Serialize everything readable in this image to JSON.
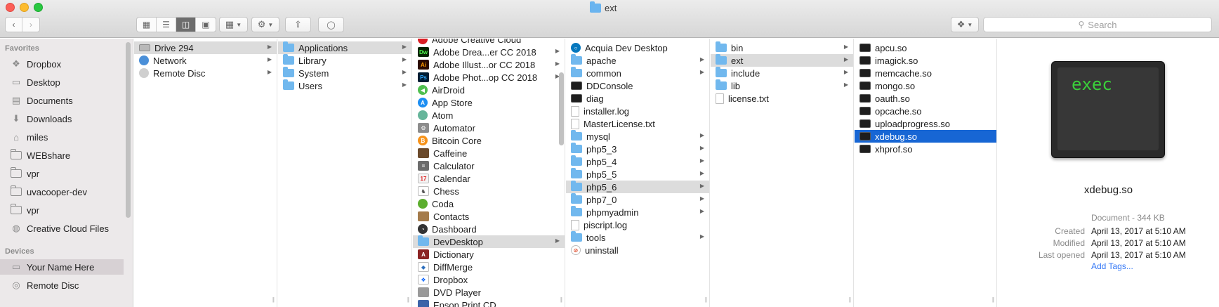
{
  "window": {
    "title": "ext",
    "search_placeholder": "Search"
  },
  "sidebar": {
    "favorites_label": "Favorites",
    "devices_label": "Devices",
    "favorites": [
      {
        "label": "Dropbox",
        "icon": "dropbox-icon"
      },
      {
        "label": "Desktop",
        "icon": "desktop-icon"
      },
      {
        "label": "Documents",
        "icon": "documents-icon"
      },
      {
        "label": "Downloads",
        "icon": "downloads-icon"
      },
      {
        "label": "miles",
        "icon": "home-icon"
      },
      {
        "label": "WEBshare",
        "icon": "folder-icon"
      },
      {
        "label": "vpr",
        "icon": "folder-icon"
      },
      {
        "label": "uvacooper-dev",
        "icon": "folder-icon"
      },
      {
        "label": "vpr",
        "icon": "folder-icon"
      },
      {
        "label": "Creative Cloud Files",
        "icon": "creative-cloud-icon"
      }
    ],
    "devices": [
      {
        "label": "Your Name Here",
        "icon": "computer-icon"
      },
      {
        "label": "Remote Disc",
        "icon": "disc-icon"
      }
    ]
  },
  "columns": {
    "col1": [
      {
        "label": "Drive 294",
        "icon": "drive-icon",
        "chevron": true,
        "selected": "grey"
      },
      {
        "label": "Network",
        "icon": "globe-icon",
        "chevron": true
      },
      {
        "label": "Remote Disc",
        "icon": "disc-icon",
        "chevron": true
      }
    ],
    "col2": [
      {
        "label": "Applications",
        "icon": "folder-icon",
        "chevron": true,
        "selected": "grey"
      },
      {
        "label": "Library",
        "icon": "folder-icon",
        "chevron": true
      },
      {
        "label": "System",
        "icon": "folder-icon",
        "chevron": true
      },
      {
        "label": "Users",
        "icon": "folder-icon",
        "chevron": true
      }
    ],
    "col3": [
      {
        "label": "Adobe Creative Cloud",
        "icon": "creative-cloud-icon"
      },
      {
        "label": "Adobe Drea...er CC 2018",
        "icon": "dreamweaver-icon",
        "chevron": true
      },
      {
        "label": "Adobe Illust...or CC 2018",
        "icon": "illustrator-icon",
        "chevron": true
      },
      {
        "label": "Adobe Phot...op CC 2018",
        "icon": "photoshop-icon",
        "chevron": true
      },
      {
        "label": "AirDroid",
        "icon": "airdroid-icon"
      },
      {
        "label": "App Store",
        "icon": "app-store-icon"
      },
      {
        "label": "Atom",
        "icon": "atom-icon"
      },
      {
        "label": "Automator",
        "icon": "automator-icon"
      },
      {
        "label": "Bitcoin Core",
        "icon": "bitcoin-icon"
      },
      {
        "label": "Caffeine",
        "icon": "caffeine-icon"
      },
      {
        "label": "Calculator",
        "icon": "calculator-icon"
      },
      {
        "label": "Calendar",
        "icon": "calendar-icon"
      },
      {
        "label": "Chess",
        "icon": "chess-icon"
      },
      {
        "label": "Coda",
        "icon": "coda-icon"
      },
      {
        "label": "Contacts",
        "icon": "contacts-icon"
      },
      {
        "label": "Dashboard",
        "icon": "dashboard-icon"
      },
      {
        "label": "DevDesktop",
        "icon": "folder-icon",
        "chevron": true,
        "selected": "grey"
      },
      {
        "label": "Dictionary",
        "icon": "dictionary-icon"
      },
      {
        "label": "DiffMerge",
        "icon": "diffmerge-icon"
      },
      {
        "label": "Dropbox",
        "icon": "dropbox-icon"
      },
      {
        "label": "DVD Player",
        "icon": "dvd-player-icon"
      },
      {
        "label": "Epson Print CD",
        "icon": "epson-icon"
      }
    ],
    "col4": [
      {
        "label": "Acquia Dev Desktop",
        "icon": "acquia-icon"
      },
      {
        "label": "apache",
        "icon": "folder-icon",
        "chevron": true
      },
      {
        "label": "common",
        "icon": "folder-icon",
        "chevron": true
      },
      {
        "label": "DDConsole",
        "icon": "terminal-icon"
      },
      {
        "label": "diag",
        "icon": "terminal-icon"
      },
      {
        "label": "installer.log",
        "icon": "document-icon"
      },
      {
        "label": "MasterLicense.txt",
        "icon": "document-icon"
      },
      {
        "label": "mysql",
        "icon": "folder-icon",
        "chevron": true
      },
      {
        "label": "php5_3",
        "icon": "folder-icon",
        "chevron": true
      },
      {
        "label": "php5_4",
        "icon": "folder-icon",
        "chevron": true
      },
      {
        "label": "php5_5",
        "icon": "folder-icon",
        "chevron": true
      },
      {
        "label": "php5_6",
        "icon": "folder-icon",
        "chevron": true,
        "selected": "grey"
      },
      {
        "label": "php7_0",
        "icon": "folder-icon",
        "chevron": true
      },
      {
        "label": "phpmyadmin",
        "icon": "folder-icon",
        "chevron": true
      },
      {
        "label": "piscript.log",
        "icon": "document-icon"
      },
      {
        "label": "tools",
        "icon": "folder-icon",
        "chevron": true
      },
      {
        "label": "uninstall",
        "icon": "uninstall-icon"
      }
    ],
    "col5": [
      {
        "label": "bin",
        "icon": "folder-icon",
        "chevron": true
      },
      {
        "label": "ext",
        "icon": "folder-icon",
        "chevron": true,
        "selected": "grey"
      },
      {
        "label": "include",
        "icon": "folder-icon",
        "chevron": true
      },
      {
        "label": "lib",
        "icon": "folder-icon",
        "chevron": true
      },
      {
        "label": "license.txt",
        "icon": "document-icon"
      }
    ],
    "col6": [
      {
        "label": "apcu.so",
        "icon": "terminal-icon"
      },
      {
        "label": "imagick.so",
        "icon": "terminal-icon"
      },
      {
        "label": "memcache.so",
        "icon": "terminal-icon"
      },
      {
        "label": "mongo.so",
        "icon": "terminal-icon"
      },
      {
        "label": "oauth.so",
        "icon": "terminal-icon"
      },
      {
        "label": "opcache.so",
        "icon": "terminal-icon"
      },
      {
        "label": "uploadprogress.so",
        "icon": "terminal-icon"
      },
      {
        "label": "xdebug.so",
        "icon": "terminal-icon",
        "selected": "blue"
      },
      {
        "label": "xhprof.so",
        "icon": "terminal-icon"
      }
    ]
  },
  "preview": {
    "icon_text": "exec",
    "name": "xdebug.so",
    "kind_size": "Document - 344 KB",
    "created_label": "Created",
    "created_value": "April 13, 2017 at 5:10 AM",
    "modified_label": "Modified",
    "modified_value": "April 13, 2017 at 5:10 AM",
    "opened_label": "Last opened",
    "opened_value": "April 13, 2017 at 5:10 AM",
    "add_tags": "Add Tags..."
  },
  "colors": {
    "accent": "#1766d4",
    "folder": "#71b8ee",
    "sidebar_bg": "#ece9ea",
    "exec_green": "#3ad03a"
  }
}
